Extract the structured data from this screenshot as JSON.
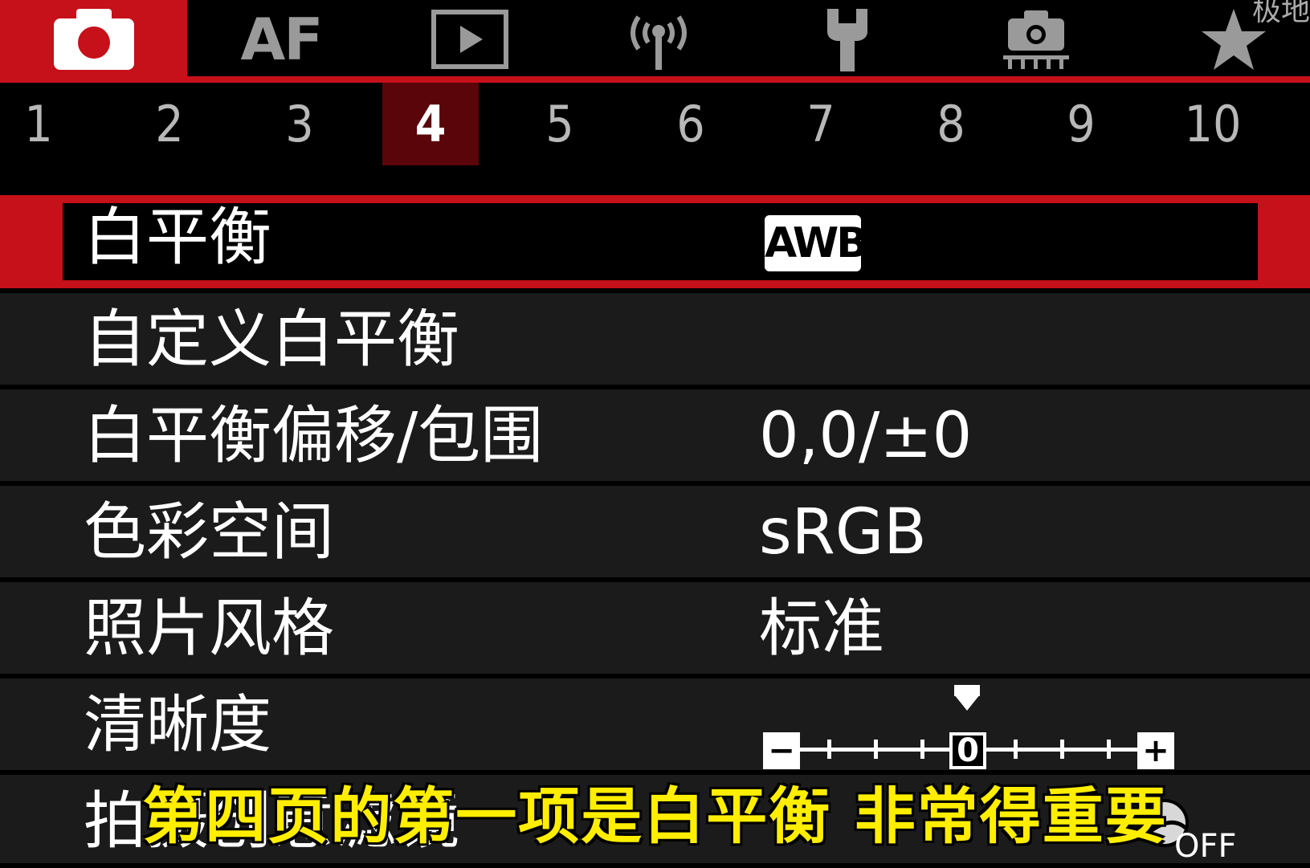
{
  "tabs": {
    "shooting_icon": "camera-icon",
    "af_label": "AF",
    "playback_icon": "playback-icon",
    "wireless_icon": "wireless-icon",
    "setup_icon": "wrench-icon",
    "custom_icon": "camera-settings-icon",
    "mymenu_icon": "star-icon",
    "corner_text": "极地"
  },
  "pages": [
    "1",
    "2",
    "3",
    "4",
    "5",
    "6",
    "7",
    "8",
    "9",
    "10"
  ],
  "active_page": "4",
  "menu": {
    "white_balance": {
      "label": "白平衡",
      "value": "AWB"
    },
    "custom_wb": {
      "label": "自定义白平衡"
    },
    "wb_shift": {
      "label": "白平衡偏移/包围",
      "value": "0,0/±0"
    },
    "color_space": {
      "label": "色彩空间",
      "value": "sRGB"
    },
    "picture_style": {
      "label": "照片风格",
      "value": "标准"
    },
    "sharpness": {
      "label": "清晰度",
      "scale_min": "−",
      "scale_mid": "0",
      "scale_max": "+",
      "level": 0
    },
    "creative_filter": {
      "label": "拍摄创意滤镜",
      "value": "OFF"
    }
  },
  "subtitle": "第四页的第一项是白平衡 非常得重要",
  "colors": {
    "accent": "#c6101a",
    "subtitle": "#ffee00"
  }
}
